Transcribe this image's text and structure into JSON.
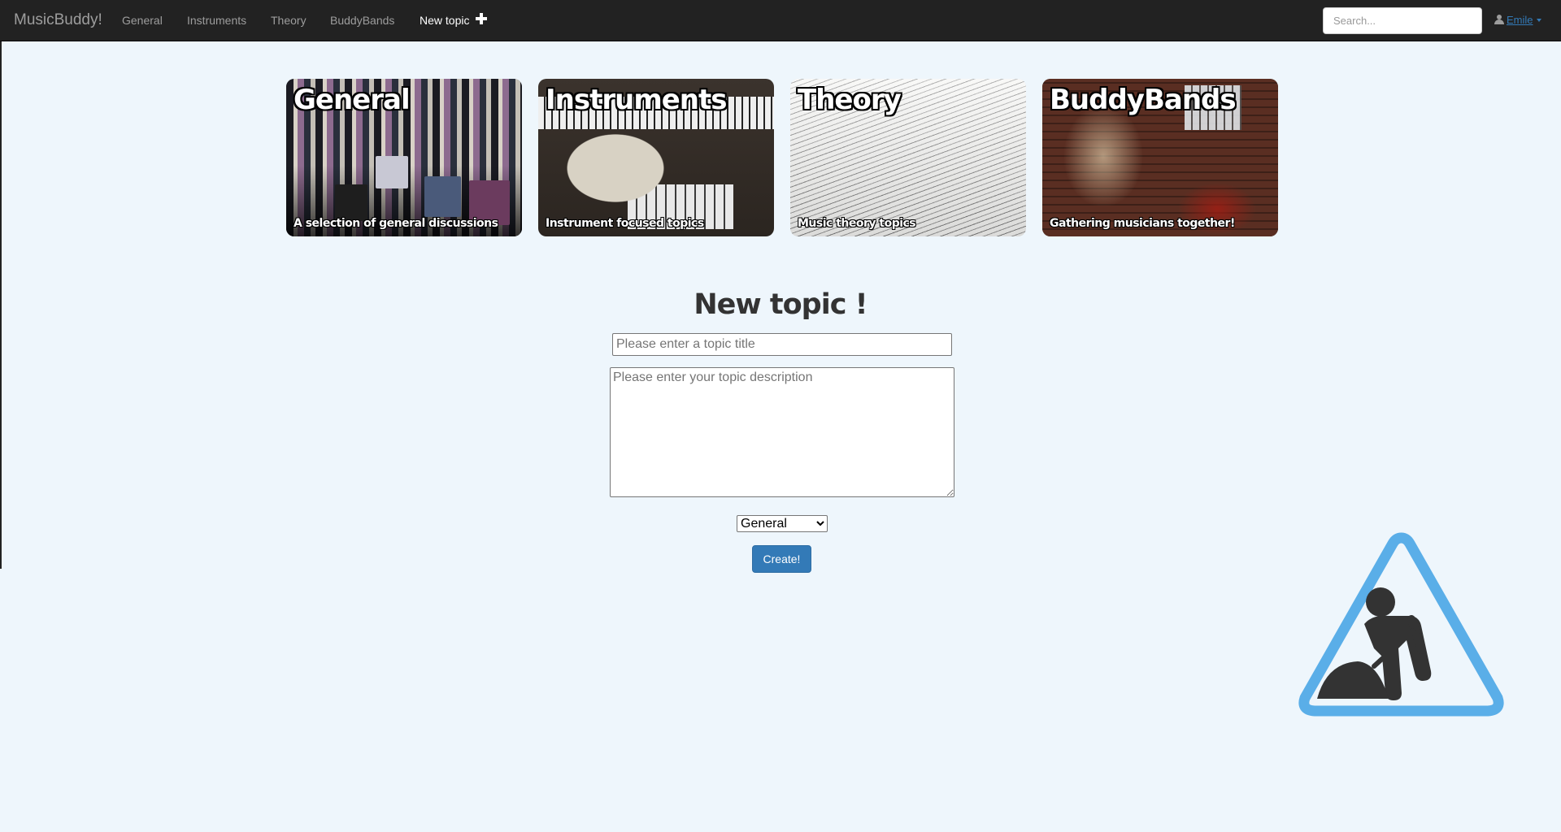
{
  "navbar": {
    "brand": "MusicBuddy!",
    "items": [
      {
        "label": "General"
      },
      {
        "label": "Instruments"
      },
      {
        "label": "Theory"
      },
      {
        "label": "BuddyBands"
      },
      {
        "label": "New topic"
      }
    ],
    "search_placeholder": "Search...",
    "user": "Emile"
  },
  "categories": [
    {
      "title": "General",
      "subtitle": "A selection of general discussions"
    },
    {
      "title": "Instruments",
      "subtitle": "Instrument focused topics"
    },
    {
      "title": "Theory",
      "subtitle": "Music theory topics"
    },
    {
      "title": "BuddyBands",
      "subtitle": "Gathering musicians together!"
    }
  ],
  "form": {
    "heading": "New topic !",
    "title_placeholder": "Please enter a topic title",
    "description_placeholder": "Please enter your topic description",
    "category_selected": "General",
    "submit_label": "Create!"
  },
  "colors": {
    "navbar_bg": "#222222",
    "page_bg": "#eef6fc",
    "primary": "#337ab7",
    "sign_blue": "#5aaee8",
    "sign_figure": "#333333"
  }
}
